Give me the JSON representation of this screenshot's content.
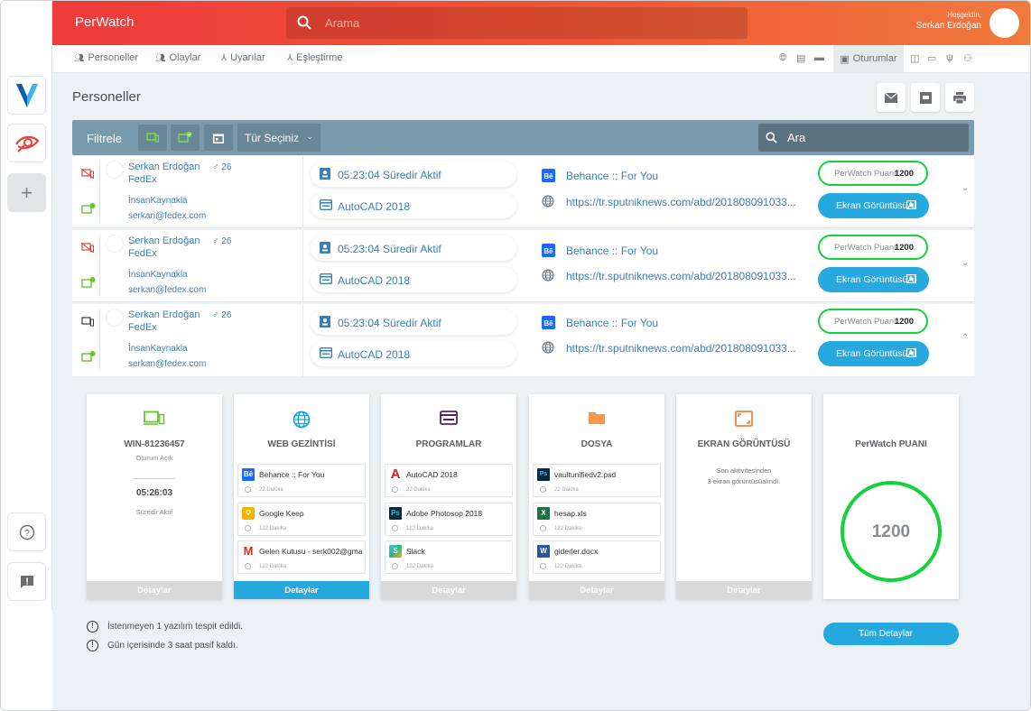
{
  "app": {
    "brand": "PerWatch",
    "search_placeholder": "Arama",
    "welcome": "Hoşgeldin,",
    "user_name": "Serkan Erdoğan"
  },
  "colors": {
    "accent_red": "#ee3b3b",
    "accent_orange": "#f07a3e",
    "primary_blue": "#26a9df",
    "score_green": "#14d23c",
    "filter_bar": "#7a9bad"
  },
  "nav": {
    "items": [
      {
        "label": "Personeller",
        "icon": "people-icon"
      },
      {
        "label": "Olaylar",
        "icon": "people-icon"
      },
      {
        "label": "Uyarılar",
        "icon": "hierarchy-icon"
      },
      {
        "label": "Eşleştirme",
        "icon": "hierarchy-icon"
      }
    ],
    "active_right": "Oturumlar"
  },
  "page": {
    "title": "Personeller"
  },
  "filter": {
    "label": "Filtrele",
    "type_select": "Tür Seçiniz",
    "search_placeholder": "Ara"
  },
  "rows": [
    {
      "name": "Serkan Erdoğan",
      "gender": "♂",
      "age": "26",
      "company": "FedEx",
      "department": "İnsanKaynakla",
      "email": "serkan@fedex.com",
      "session": "05:23:04 Süredir Aktif",
      "program": "AutoCAD 2018",
      "web_title": "Behance :: For You",
      "web_url": "https://tr.sputniknews.com/abd/201808091033...",
      "score_label": "PerWatch Puanı",
      "score": "1200",
      "shot_label": "Ekran GörüntüsüAl",
      "chevron": "⌄"
    },
    {
      "name": "Serkan Erdoğan",
      "gender": "♂",
      "age": "26",
      "company": "FedEx",
      "department": "İnsanKaynakla",
      "email": "serkan@fedex.com",
      "session": "05:23:04 Süredir Aktif",
      "program": "AutoCAD 2018",
      "web_title": "Behance :: For You",
      "web_url": "https://tr.sputniknews.com/abd/201808091033...",
      "score_label": "PerWatch Puanı",
      "score": "1200",
      "shot_label": "Ekran GörüntüsüAl",
      "chevron": "⌄"
    },
    {
      "name": "Serkan Erdoğan",
      "gender": "♂",
      "age": "26",
      "company": "FedEx",
      "department": "İnsanKaynakla",
      "email": "serkan@fedex.com",
      "session": "05:23:04 Süredir Aktif",
      "program": "AutoCAD 2018",
      "web_title": "Behance :: For You",
      "web_url": "https://tr.sputniknews.com/abd/201808091033...",
      "score_label": "PerWatch Puanı",
      "score": "1200",
      "shot_label": "Ekran GörüntüsüAl",
      "chevron": "⌃"
    }
  ],
  "detail": {
    "device": {
      "title": "WIN-81236457",
      "status": "Oturum Açık",
      "time": "05:26:03",
      "time_label": "Süredir Aktif",
      "footer": "Detaylar"
    },
    "web": {
      "title": "WEB GEZİNTİSİ",
      "footer": "Detaylar",
      "items": [
        {
          "name": "Behance :: For You",
          "time": "22 Dakika",
          "icon": "behance-icon"
        },
        {
          "name": "Google Keep",
          "time": "122 Dakika",
          "icon": "keep-icon"
        },
        {
          "name": "Gelen Kutusu - serk002@gma",
          "time": "122 Dakika",
          "icon": "gmail-icon"
        }
      ]
    },
    "programs": {
      "title": "PROGRAMLAR",
      "footer": "Detaylar",
      "items": [
        {
          "name": "AutoCAD 2018",
          "time": "22 Dakika",
          "icon": "autocad-icon"
        },
        {
          "name": "Adobe Photosop 2018",
          "time": "122 Dakika",
          "icon": "photoshop-icon"
        },
        {
          "name": "Slack",
          "time": "122 Dakika",
          "icon": "slack-icon"
        }
      ]
    },
    "files": {
      "title": "DOSYA",
      "footer": "Detaylar",
      "items": [
        {
          "name": "vaultunifiedv2.psd",
          "time": "22 Dakika",
          "icon": "psd-file-icon"
        },
        {
          "name": "hesap.xls",
          "time": "122 Dakika",
          "icon": "excel-file-icon"
        },
        {
          "name": "giderler.docx",
          "time": "122 Dakika",
          "icon": "word-file-icon"
        }
      ]
    },
    "screenshots": {
      "title": "EKRAN GÖRÜNTÜSÜ",
      "text1": "Son aktivitesinden",
      "text2": "3 ekran görüntüsüalındı.",
      "footer": "Detaylar"
    },
    "score": {
      "title": "PerWatch PUANI",
      "value": "1200"
    },
    "notes": [
      "İstenmeyen 1 yazılım tespit edildi.",
      "Gün içerisinde 3 saat pasif kaldı."
    ],
    "all_details": "Tüm Detaylar",
    "all_details_arrow": "→"
  }
}
